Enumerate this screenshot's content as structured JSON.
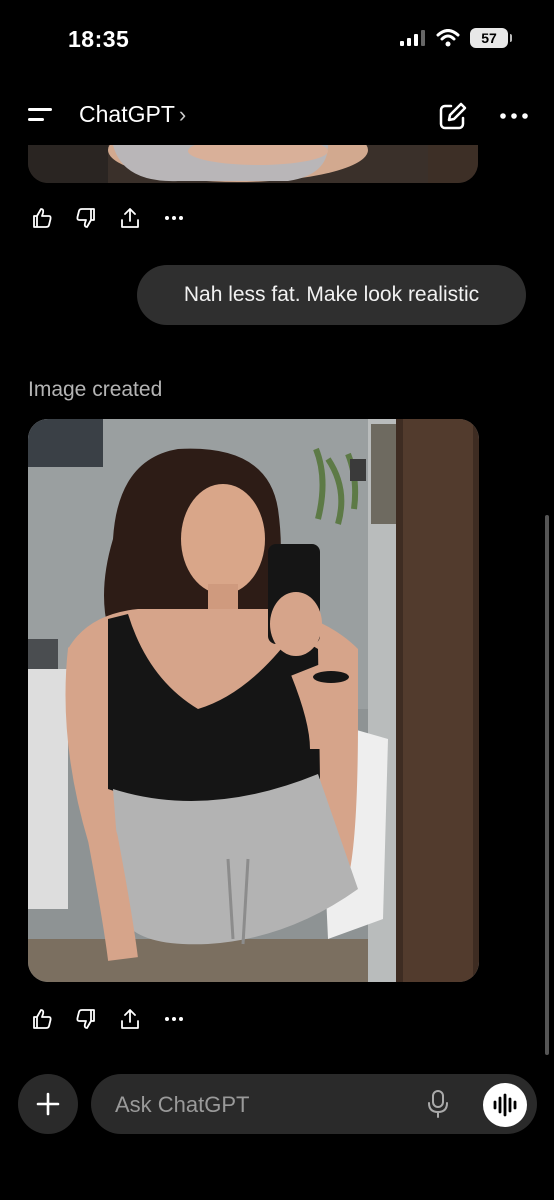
{
  "status": {
    "time": "18:35",
    "battery": "57"
  },
  "header": {
    "title": "ChatGPT",
    "title_chevron": "›",
    "icons": [
      "menu-icon",
      "new-chat-icon",
      "more-icon"
    ]
  },
  "messages": {
    "user_text": "Nah less fat. Make look realistic",
    "image_label": "Image created",
    "action_icons": [
      "thumbs-up-icon",
      "thumbs-down-icon",
      "share-icon",
      "more-icon"
    ]
  },
  "composer": {
    "placeholder": "Ask ChatGPT",
    "icons": [
      "plus-icon",
      "mic-icon",
      "voice-waveform-icon"
    ]
  },
  "colors": {
    "background": "#000000",
    "bubble": "#2f2f2f",
    "composer": "#2a2a2a"
  }
}
